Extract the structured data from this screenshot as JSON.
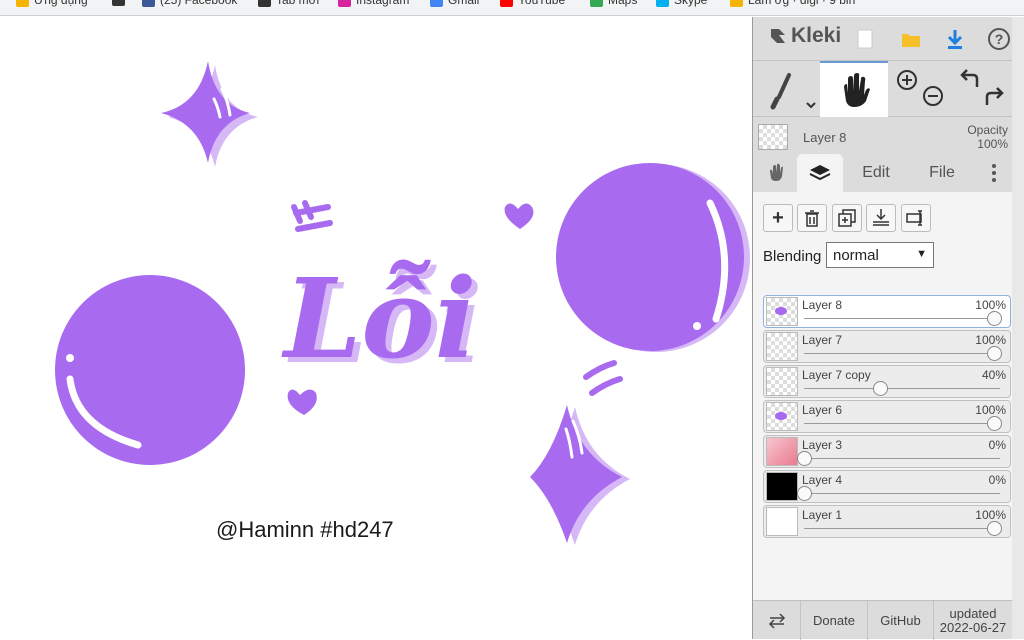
{
  "bookmarks": [
    {
      "label": "Ứng dụng",
      "icon": "apps-icon",
      "color": "#f4b400"
    },
    {
      "label": "",
      "icon": "site-icon",
      "color": "#333333"
    },
    {
      "label": "(25) Facebook",
      "icon": "facebook-icon",
      "color": "#3b5998"
    },
    {
      "label": "Tab mới",
      "icon": "site-icon",
      "color": "#333333"
    },
    {
      "label": "Instagram",
      "icon": "instagram-icon",
      "color": "#d6249f"
    },
    {
      "label": "Gmail",
      "icon": "gmail-icon",
      "color": "#4285f4"
    },
    {
      "label": "YouTube",
      "icon": "youtube-icon",
      "color": "#ff0000"
    },
    {
      "label": "Maps",
      "icon": "maps-icon",
      "color": "#34a853"
    },
    {
      "label": "Skype",
      "icon": "skype-icon",
      "color": "#00aff0"
    },
    {
      "label": "Làm ơg · digi · 9 bin",
      "icon": "apps-icon",
      "color": "#f4b400"
    }
  ],
  "canvas": {
    "watermark": "@Haminn #hd247",
    "artwork_word": "Lỗi",
    "accent": "#a86bf0",
    "accent_light": "#d6b8f7"
  },
  "app": {
    "name": "Kleki",
    "icons": [
      "new-image-icon",
      "open-folder-icon",
      "download-icon",
      "help-icon"
    ]
  },
  "tools": {
    "brush": "brush-icon",
    "hand": "hand-icon",
    "zoom_in": "zoom-in-icon",
    "zoom_out": "zoom-out-icon",
    "undo": "undo-icon",
    "redo": "redo-icon"
  },
  "current_layer": {
    "name": "Layer 8",
    "opacity_label": "Opacity",
    "opacity_value": "100%"
  },
  "tabs": {
    "hand": "hand-icon",
    "layers": "layers-icon",
    "edit": "Edit",
    "file": "File",
    "more": "more-icon"
  },
  "layer_actions": [
    "add-layer-icon",
    "delete-layer-icon",
    "duplicate-layer-icon",
    "merge-down-icon",
    "rename-layer-icon"
  ],
  "blending": {
    "label": "Blending",
    "value": "normal"
  },
  "layers": [
    {
      "name": "Layer 8",
      "opacity": "100%",
      "level": 1.0,
      "active": true,
      "thumb": "purple-dots"
    },
    {
      "name": "Layer 7",
      "opacity": "100%",
      "level": 1.0,
      "active": false,
      "thumb": "checker"
    },
    {
      "name": "Layer 7 copy",
      "opacity": "40%",
      "level": 0.4,
      "active": false,
      "thumb": "checker"
    },
    {
      "name": "Layer 6",
      "opacity": "100%",
      "level": 1.0,
      "active": false,
      "thumb": "purple-dots"
    },
    {
      "name": "Layer 3",
      "opacity": "0%",
      "level": 0.0,
      "active": false,
      "thumb": "pink"
    },
    {
      "name": "Layer 4",
      "opacity": "0%",
      "level": 0.0,
      "active": false,
      "thumb": "black"
    },
    {
      "name": "Layer 1",
      "opacity": "100%",
      "level": 1.0,
      "active": false,
      "thumb": "white"
    }
  ],
  "footer": {
    "swap": "swap-icon",
    "donate": "Donate",
    "github": "GitHub",
    "updated_label": "updated",
    "updated_date": "2022-06-27"
  }
}
